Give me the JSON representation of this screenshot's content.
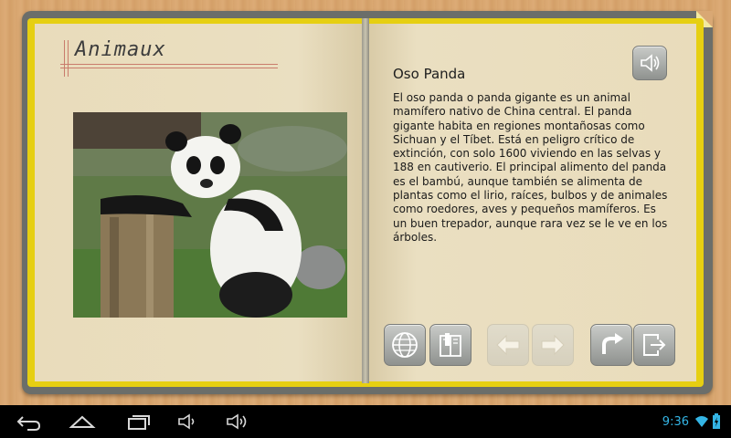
{
  "app": {
    "title": "Animaux"
  },
  "article": {
    "heading": "Oso Panda",
    "body": "El oso panda o panda gigante es un animal mamífero nativo de China central. El panda gigante habita en regiones montañosas como Sichuan y el Tíbet. Está en peligro crítico de extinción, con solo 1600 viviendo en las selvas y 188 en cautiverio. El principal alimento del panda es el bambú, aunque también se alimenta de plantas como el lirio, raíces, bulbos y de animales como roedores, aves y pequeños mamíferos. Es un buen trepador, aunque rara vez se le ve en los árboles."
  },
  "toolbar": {
    "buttons": [
      {
        "name": "globe-button",
        "icon": "globe-icon",
        "enabled": true
      },
      {
        "name": "book-button",
        "icon": "book-icon",
        "enabled": true
      },
      {
        "name": "previous-button",
        "icon": "arrow-left-icon",
        "enabled": false
      },
      {
        "name": "next-button",
        "icon": "arrow-right-icon",
        "enabled": false
      },
      {
        "name": "replay-button",
        "icon": "redo-arrow-icon",
        "enabled": true
      },
      {
        "name": "exit-button",
        "icon": "exit-icon",
        "enabled": true
      }
    ],
    "speaker": {
      "icon": "speaker-icon"
    }
  },
  "statusbar": {
    "time": "9:36"
  },
  "colors": {
    "book_cover": "#6b6e6a",
    "book_border": "#e6cf12",
    "page": "#e9dcbc",
    "accent": "#34b5e5"
  }
}
